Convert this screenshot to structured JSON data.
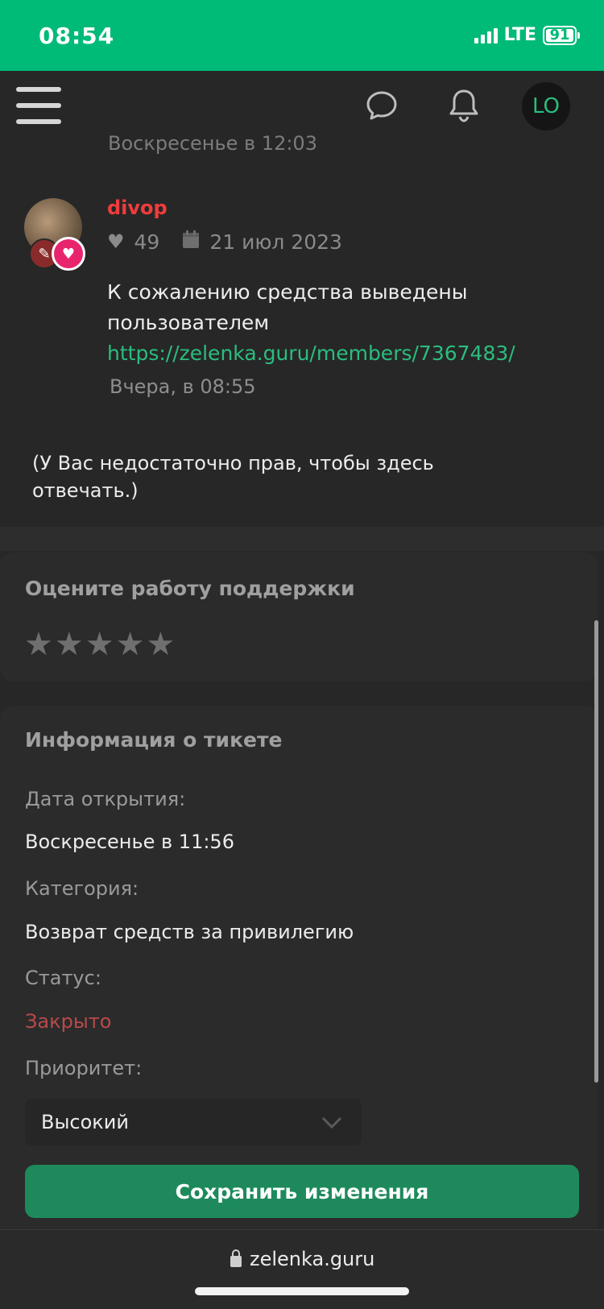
{
  "status_bar": {
    "time": "08:54",
    "network": "LTE",
    "battery": "91"
  },
  "header": {
    "avatar_initials": "LO"
  },
  "thread": {
    "previous_time_partial": "Воскресенье в 12:03",
    "post": {
      "username": "divop",
      "likes": "49",
      "date": "21 июл 2023",
      "message_line1": "К сожалению средства выведены",
      "message_line2": "пользователем",
      "link": "https://zelenka.guru/members/7367483/",
      "time": "Вчера, в 08:55"
    },
    "no_permission": "(У Вас недостаточно прав, чтобы здесь отвечать.)"
  },
  "rating": {
    "title": "Оцените работу поддержки",
    "stars_total": 5,
    "stars_selected": 0
  },
  "ticket_info": {
    "title": "Информация о тикете",
    "open_date_label": "Дата открытия:",
    "open_date_value": "Воскресенье в 11:56",
    "category_label": "Категория:",
    "category_value": "Возврат средств за привилегию",
    "status_label": "Статус:",
    "status_value": "Закрыто",
    "priority_label": "Приоритет:",
    "priority_value": "Высокий",
    "save_button": "Сохранить изменения"
  },
  "browser": {
    "domain": "zelenka.guru"
  },
  "colors": {
    "accent": "#00ba78",
    "link": "#2bbd7e",
    "username": "#f03c3c",
    "status_closed": "#b84a4a",
    "save_button": "#1e8a5c"
  }
}
